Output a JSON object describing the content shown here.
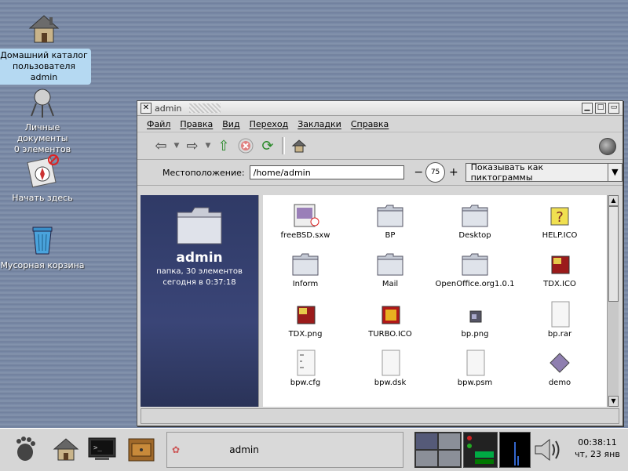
{
  "desktop": {
    "icons": [
      {
        "label": "Домашний каталог пользователя admin",
        "line1": "Домашний каталог",
        "line2": "пользователя admin",
        "selected": true
      },
      {
        "label": "Личные документы",
        "line1": "Личные документы",
        "line2": "0 элементов"
      },
      {
        "label": "Начать здесь",
        "line1": "Начать здесь",
        "line2": ""
      },
      {
        "label": "Мусорная корзина",
        "line1": "Мусорная корзина",
        "line2": ""
      }
    ]
  },
  "window": {
    "title": "admin",
    "menu": [
      "Файл",
      "Правка",
      "Вид",
      "Переход",
      "Закладки",
      "Справка"
    ],
    "toolbar": {
      "icons": [
        "back-icon",
        "forward-icon",
        "up-icon",
        "stop-icon",
        "reload-icon",
        "home-icon"
      ]
    },
    "location": {
      "label": "Местоположение:",
      "value": "/home/admin"
    },
    "zoom": {
      "level": "75",
      "minus": "−",
      "plus": "+"
    },
    "view_select": {
      "selected": "Показывать как пиктограммы"
    },
    "sidepanel": {
      "name": "admin",
      "info1": "папка, 30 элементов",
      "info2": "сегодня в 0:37:18"
    },
    "files": [
      {
        "name": "freeBSD.sxw",
        "kind": "doc"
      },
      {
        "name": "BP",
        "kind": "folder"
      },
      {
        "name": "Desktop",
        "kind": "folder"
      },
      {
        "name": "HELP.ICO",
        "kind": "help"
      },
      {
        "name": "Inform",
        "kind": "folder"
      },
      {
        "name": "Mail",
        "kind": "folder"
      },
      {
        "name": "OpenOffice.org1.0.1",
        "kind": "folder"
      },
      {
        "name": "TDX.ICO",
        "kind": "tdx"
      },
      {
        "name": "TDX.png",
        "kind": "tdx"
      },
      {
        "name": "TURBO.ICO",
        "kind": "turbo"
      },
      {
        "name": "bp.png",
        "kind": "png"
      },
      {
        "name": "bp.rar",
        "kind": "blank"
      },
      {
        "name": "bpw.cfg",
        "kind": "text"
      },
      {
        "name": "bpw.dsk",
        "kind": "blank"
      },
      {
        "name": "bpw.psm",
        "kind": "blank"
      },
      {
        "name": "demo",
        "kind": "diamond"
      }
    ]
  },
  "taskbar": {
    "task": "admin",
    "clock_time": "00:38:11",
    "clock_date": "чт, 23 янв"
  },
  "colors": {
    "sidepanel": "#3a4577",
    "desktop": "#7a8aa6",
    "selection": "#b5d9f2"
  }
}
